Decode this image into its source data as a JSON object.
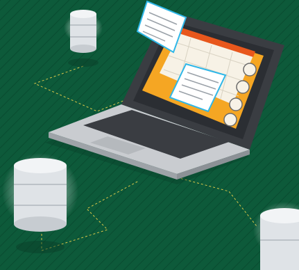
{
  "scene": {
    "background_color": "#0d5a3a",
    "pattern_color": "#0a4b30",
    "connector_color": "#d9c74a",
    "laptop_body_color": "#c9ccd0",
    "laptop_dark_color": "#3a3d42",
    "screen_accent_colors": [
      "#f5a623",
      "#e8571c",
      "#f7d04a"
    ],
    "screen_border_color": "#2fb7e8",
    "document_card_color": "#ffffff",
    "document_card_border": "#2fb7e8",
    "database_color": "#dfe3e7",
    "database_glow_color": "#ffffff",
    "icons": [
      "database-icon-top",
      "database-icon-left",
      "database-icon-bottom-right",
      "laptop-icon",
      "document-icon",
      "user-avatar-icon"
    ]
  }
}
